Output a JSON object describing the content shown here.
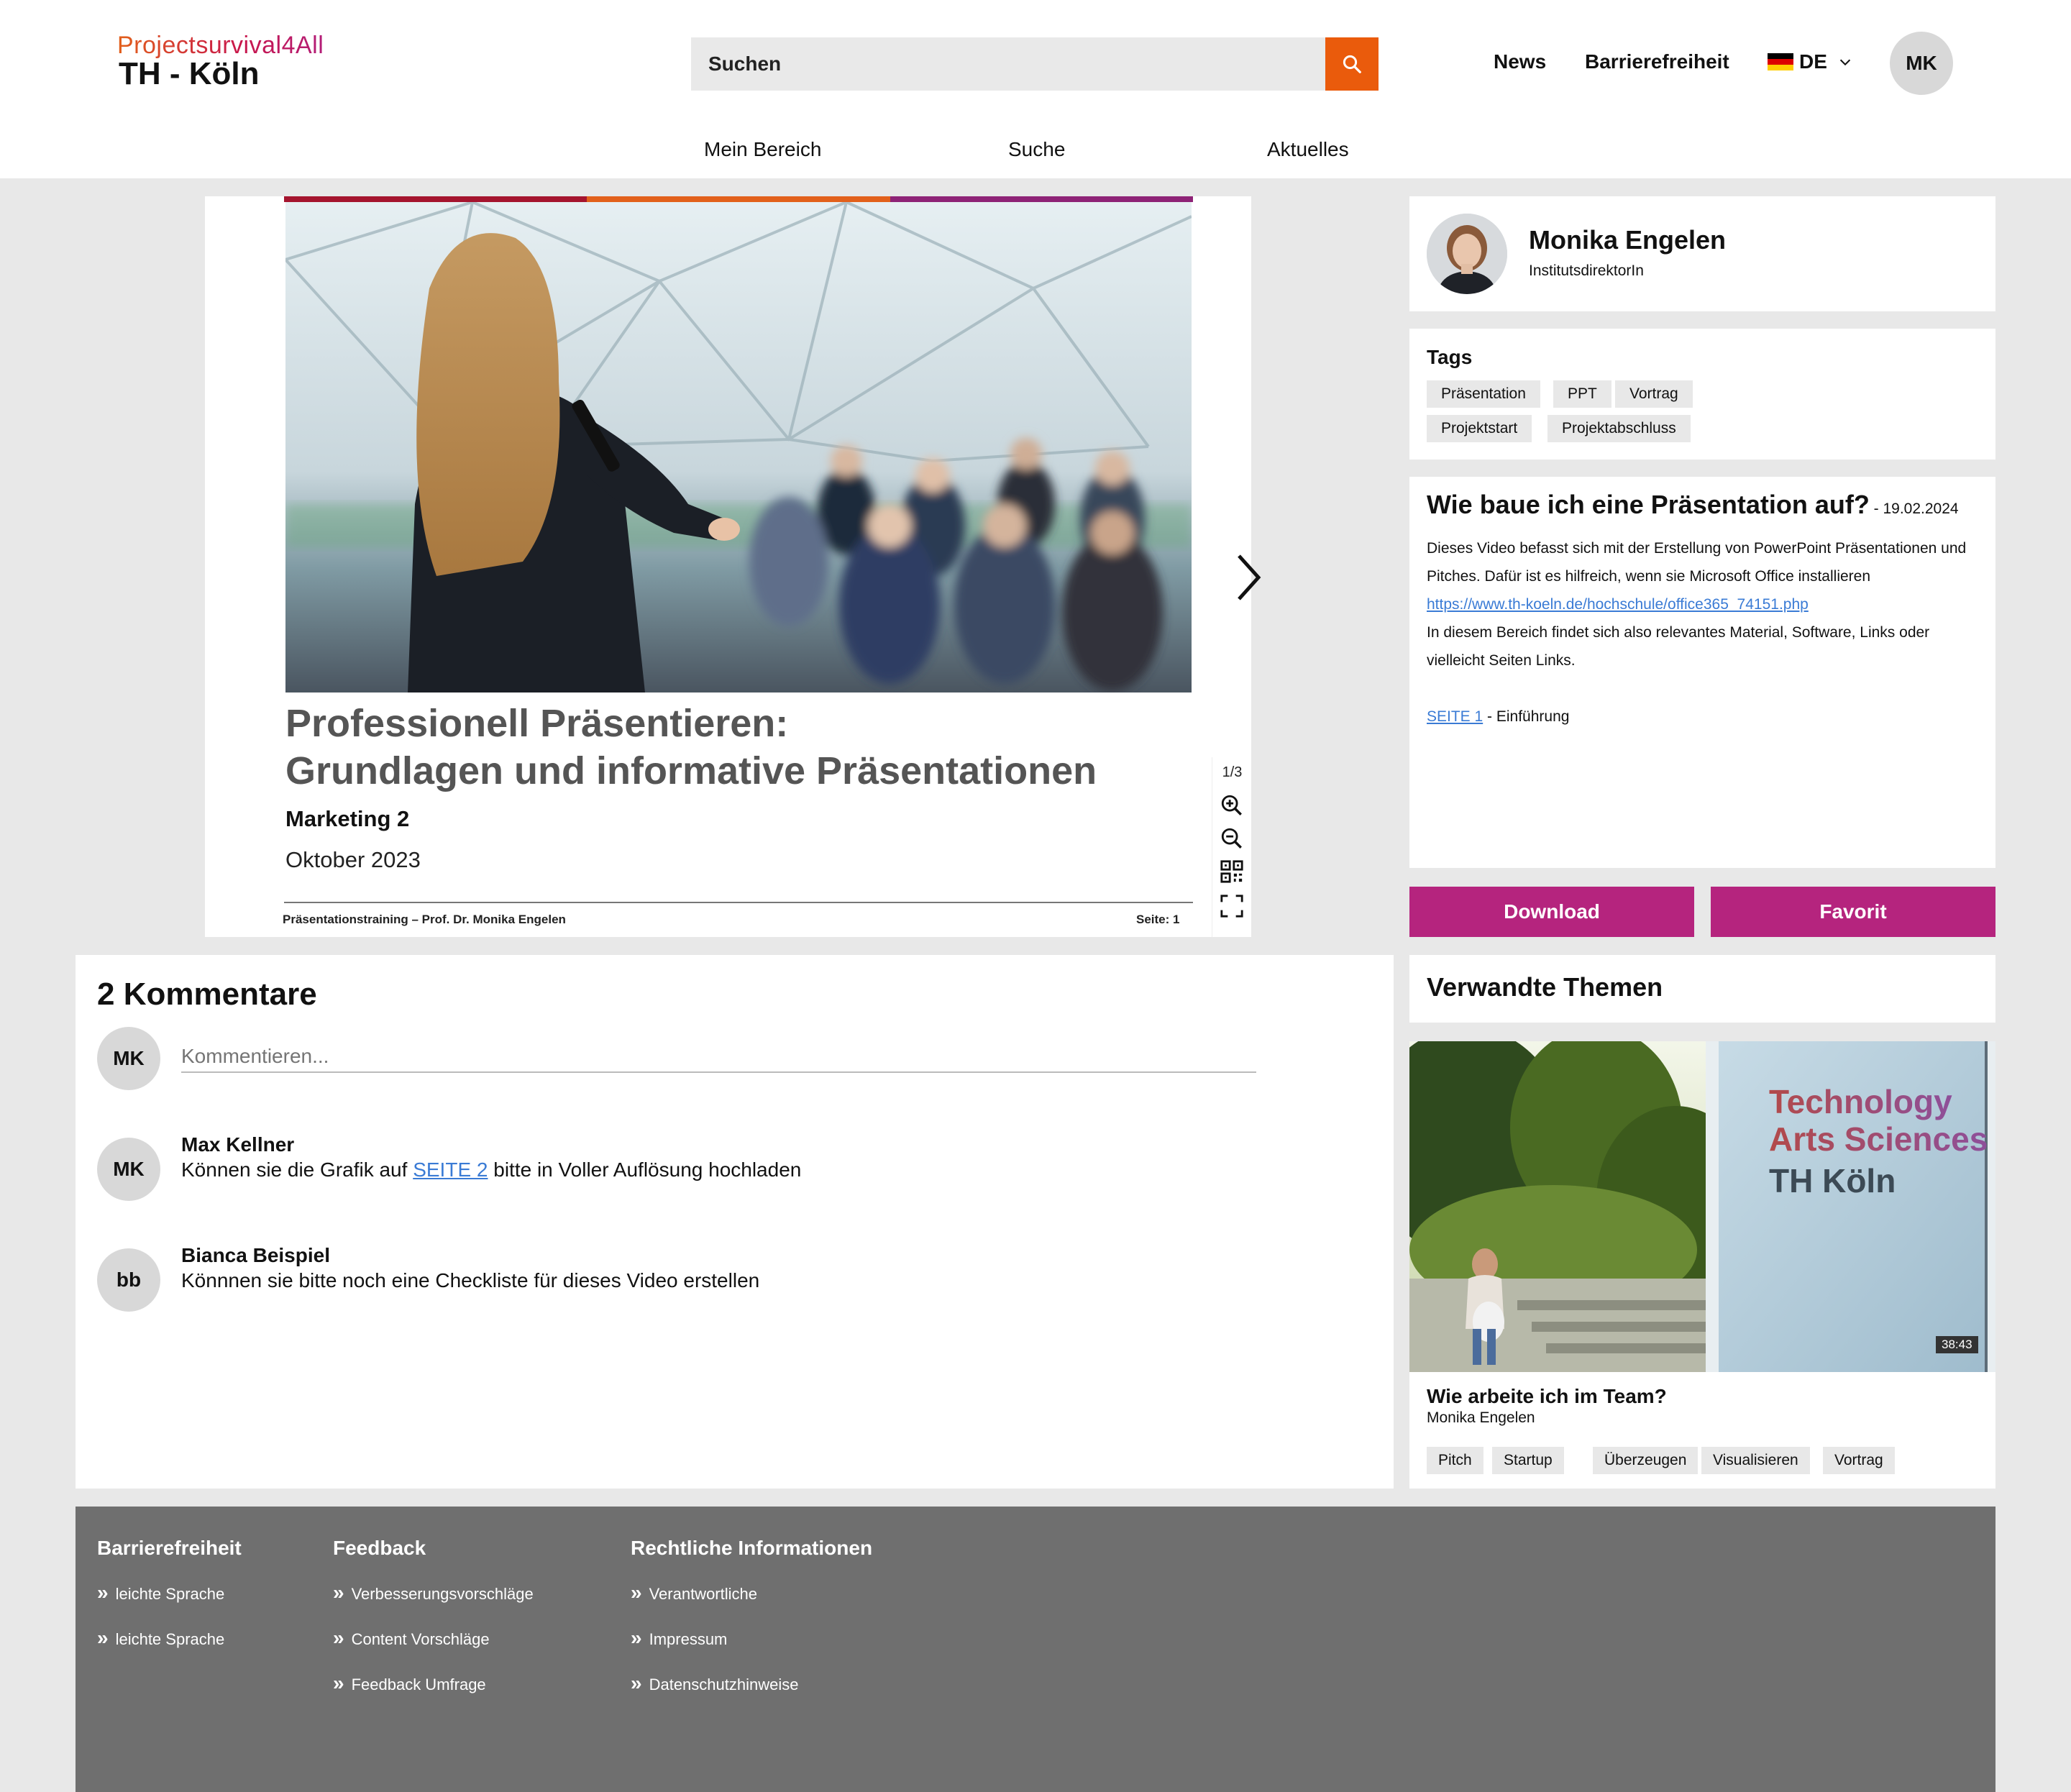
{
  "header": {
    "logo_top": "Projectsurvival4All",
    "logo_bottom": "TH - Köln",
    "search_placeholder": "Suchen",
    "links": [
      "News",
      "Barrierefreiheit"
    ],
    "language": "DE",
    "user_initials": "MK",
    "nav": [
      "Mein Bereich",
      "Suche",
      "Aktuelles"
    ]
  },
  "slide": {
    "title_line1": "Professionell Präsentieren:",
    "title_line2": "Grundlagen und informative Präsentationen",
    "subtitle": "Marketing 2",
    "date": "Oktober 2023",
    "footer_left": "Präsentationstraining – Prof. Dr. Monika Engelen",
    "footer_right": "Seite: 1",
    "page_indicator": "1/3",
    "bar_colors": [
      "#a5142e",
      "#e2601b",
      "#8e2276"
    ]
  },
  "author": {
    "name": "Monika Engelen",
    "role": "InstitutsdirektorIn"
  },
  "tags": {
    "title": "Tags",
    "items": [
      "Präsentation",
      "PPT",
      "Vortrag",
      "Projektstart",
      "Projektabschluss"
    ]
  },
  "description": {
    "title": "Wie baue ich eine Präsentation auf?",
    "date": " - 19.02.2024",
    "text1": "Dieses Video befasst sich mit der Erstellung von PowerPoint Präsentationen und Pitches. Dafür ist es hilfreich, wenn sie Microsoft Office installieren",
    "link": "https://www.th-koeln.de/hochschule/office365_74151.php",
    "text2": "In diesem Bereich findet sich also relevantes Material, Software, Links oder vielleicht Seiten Links.",
    "page_link": "SEITE 1",
    "page_text": " - Einführung"
  },
  "buttons": {
    "download": "Download",
    "favorite": "Favorit"
  },
  "comments": {
    "title": "2 Kommentare",
    "input_placeholder": "Kommentieren...",
    "user_initials": "MK",
    "items": [
      {
        "initials": "MK",
        "author": "Max Kellner",
        "text_before": "Können sie die Grafik auf ",
        "link": "SEITE 2",
        "text_after": " bitte in Voller Auflösung hochladen"
      },
      {
        "initials": "bb",
        "author": "Bianca Beispiel",
        "text_before": "Könnnen sie bitte noch eine Checkliste für dieses Video erstellen",
        "link": "",
        "text_after": ""
      }
    ]
  },
  "related": {
    "title": "Verwandte Themen",
    "image_text1": "Technology",
    "image_text2": "Arts Sciences",
    "image_text3": "TH Köln",
    "duration": "38:43",
    "video_title": "Wie arbeite ich im Team?",
    "video_author": "Monika Engelen",
    "tags": [
      "Pitch",
      "Startup",
      "Überzeugen",
      "Visualisieren",
      "Vortrag"
    ]
  },
  "footer": {
    "col1": {
      "title": "Barrierefreiheit",
      "items": [
        "leichte Sprache",
        "leichte Sprache"
      ]
    },
    "col2": {
      "title": "Feedback",
      "items": [
        "Verbesserungsvorschläge",
        "Content Vorschläge",
        "Feedback Umfrage"
      ]
    },
    "col3": {
      "title": "Rechtliche Informationen",
      "items": [
        "Verantwortliche",
        "Impressum",
        "Datenschutzhinweise"
      ]
    }
  },
  "colors": {
    "accent_orange": "#ea5b0c",
    "accent_pink": "#b5247e",
    "footer_gray": "#6f6f6f",
    "link_blue": "#3a7bd5"
  }
}
